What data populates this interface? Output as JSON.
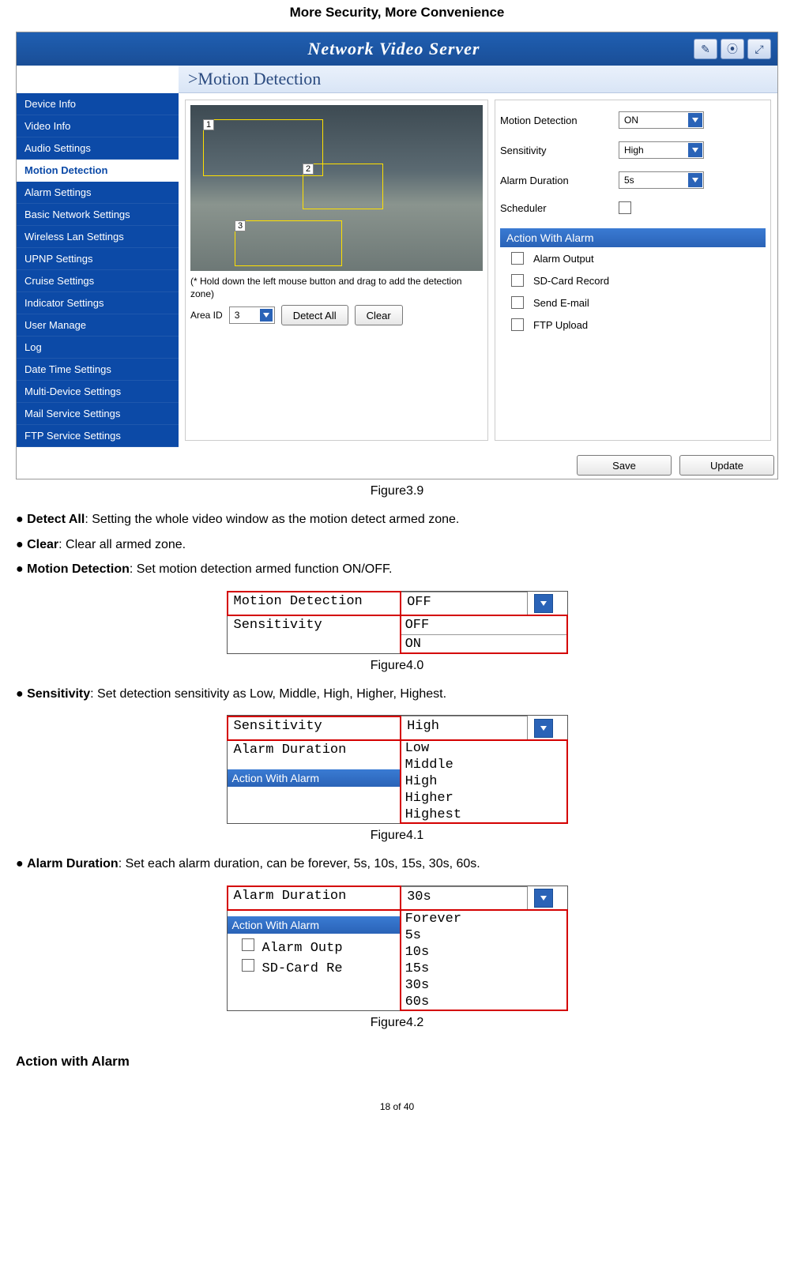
{
  "page_header": "More Security, More Convenience",
  "nvs": {
    "title": "Network Video Server",
    "breadcrumb": ">Motion Detection",
    "sidebar": {
      "items": [
        "Device Info",
        "Video Info",
        "Audio Settings",
        "Motion Detection",
        "Alarm Settings",
        "Basic Network Settings",
        "Wireless Lan Settings",
        "UPNP Settings",
        "Cruise Settings",
        "Indicator Settings",
        "User Manage",
        "Log",
        "Date Time Settings",
        "Multi-Device Settings",
        "Mail Service Settings",
        "FTP Service Settings"
      ],
      "active_index": 3
    },
    "video": {
      "hint": "(* Hold down the left mouse button and drag to add the detection zone)",
      "area_label": "Area ID",
      "area_value": "3",
      "detect_all": "Detect All",
      "clear": "Clear",
      "zones": [
        "1",
        "2",
        "3"
      ]
    },
    "settings": {
      "motion_detection": {
        "label": "Motion Detection",
        "value": "ON"
      },
      "sensitivity": {
        "label": "Sensitivity",
        "value": "High"
      },
      "alarm_duration": {
        "label": "Alarm Duration",
        "value": "5s"
      },
      "scheduler": {
        "label": "Scheduler"
      },
      "action_header": "Action With Alarm",
      "actions": [
        "Alarm Output",
        "SD-Card Record",
        "Send E-mail",
        "FTP Upload"
      ]
    },
    "buttons": {
      "save": "Save",
      "update": "Update"
    }
  },
  "fig39_caption": "Figure3.9",
  "bullet1": {
    "lead": "Detect All",
    "rest": ": Setting the whole video window as the motion detect armed zone."
  },
  "bullet2": {
    "lead": "Clear",
    "rest": ": Clear all armed zone."
  },
  "bullet3": {
    "lead": "Motion Detection",
    "rest": ": Set motion detection armed function ON/OFF."
  },
  "fig40": {
    "row1_label": "Motion Detection",
    "row1_val": "OFF",
    "row2_label": "Sensitivity",
    "options": [
      "OFF",
      "ON"
    ],
    "caption": "Figure4.0"
  },
  "bullet4": {
    "lead": "Sensitivity",
    "rest": ": Set detection sensitivity as Low, Middle, High, Higher, Highest."
  },
  "fig41": {
    "row1_label": "Sensitivity",
    "row1_val": "High",
    "row2_label": "Alarm Duration",
    "section": "Action With Alarm",
    "options": [
      "Low",
      "Middle",
      "High",
      "Higher",
      "Highest"
    ],
    "caption": "Figure4.1"
  },
  "bullet5": {
    "lead": "Alarm Duration",
    "rest": ": Set each alarm duration, can be forever, 5s, 10s, 15s, 30s, 60s."
  },
  "fig42": {
    "row1_label": "Alarm Duration",
    "row1_val": "30s",
    "section": "Action With Alarm",
    "check1": "Alarm Outp",
    "check2": "SD-Card Re",
    "options": [
      "Forever",
      "5s",
      "10s",
      "15s",
      "30s",
      "60s"
    ],
    "caption": "Figure4.2"
  },
  "section_title": "Action with Alarm",
  "footer": "18 of 40"
}
